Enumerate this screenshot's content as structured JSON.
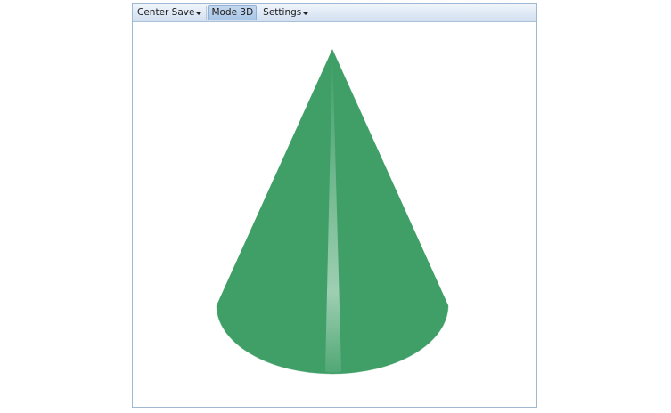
{
  "toolbar": {
    "center_save_label": "Center Save",
    "mode_label": "Mode 3D",
    "settings_label": "Settings"
  },
  "scene": {
    "object_icon": "cone-3d",
    "base_color": "#5ed896",
    "highlight_color": "#d8fff4",
    "shadow_color": "#2f8a55"
  }
}
